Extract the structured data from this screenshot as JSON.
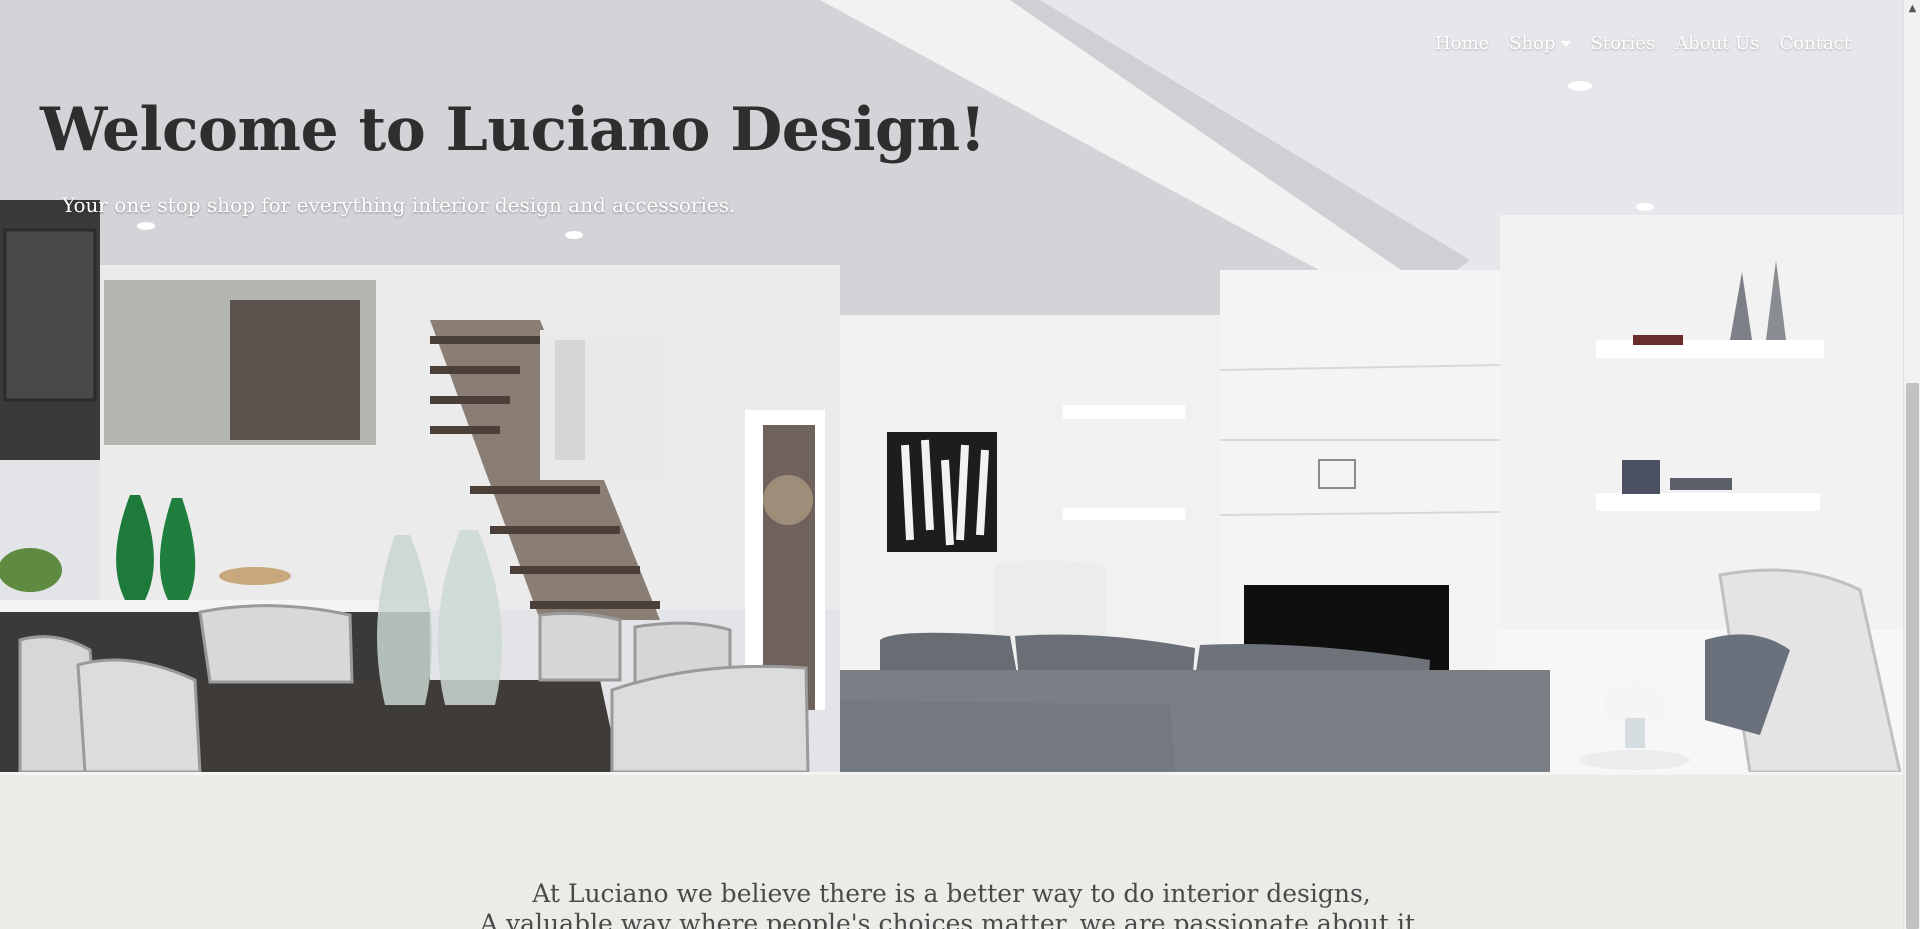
{
  "nav": {
    "items": [
      {
        "label": "Home"
      },
      {
        "label": "Shop"
      },
      {
        "label": "Stories"
      },
      {
        "label": "About Us"
      },
      {
        "label": "Contact"
      }
    ]
  },
  "hero": {
    "title": "Welcome to Luciano Design!",
    "subtitle": "Your one stop shop for everything interior design and accessories."
  },
  "intro": {
    "line1": "At Luciano we believe there is a better way to do interior designs,",
    "line2": "A valuable way where people's choices matter, we are passionate about it."
  },
  "icons": {
    "shop_dropdown": "caret-down-icon",
    "scroll_up": "chevron-up-icon"
  },
  "colors": {
    "title": "#2f2e2f",
    "nav_text": "#ffffff",
    "background": "#ebebe7",
    "intro_text": "#4a4a4a"
  }
}
